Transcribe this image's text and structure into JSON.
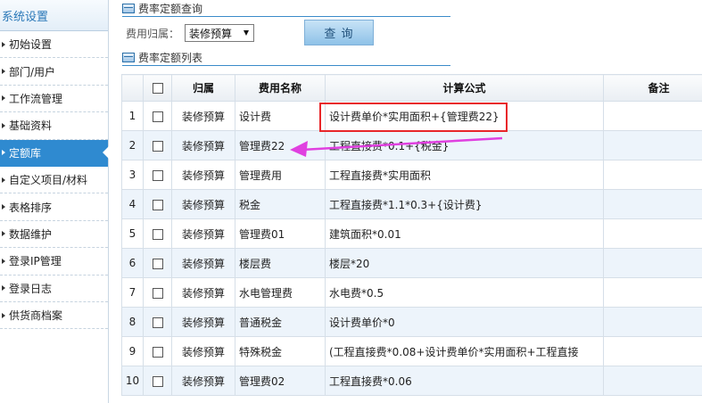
{
  "sidebar": {
    "title": "系统设置",
    "items": [
      {
        "label": "初始设置",
        "active": false
      },
      {
        "label": "部门/用户",
        "active": false
      },
      {
        "label": "工作流管理",
        "active": false
      },
      {
        "label": "基础资料",
        "active": false
      },
      {
        "label": "定额库",
        "active": true
      },
      {
        "label": "自定义项目/材料",
        "active": false
      },
      {
        "label": "表格排序",
        "active": false
      },
      {
        "label": "数据维护",
        "active": false
      },
      {
        "label": "登录IP管理",
        "active": false
      },
      {
        "label": "登录日志",
        "active": false
      },
      {
        "label": "供货商档案",
        "active": false
      }
    ]
  },
  "query": {
    "section_title": "费率定额查询",
    "filter_label": "费用归属：",
    "filter_value": "装修预算",
    "button_label": "查 询"
  },
  "list": {
    "section_title": "费率定额列表",
    "columns": {
      "owner": "归属",
      "name": "费用名称",
      "formula": "计算公式",
      "remark": "备注"
    },
    "rows": [
      {
        "no": "1",
        "owner": "装修预算",
        "name": "设计费",
        "formula": "设计费单价*实用面积+{管理费22}"
      },
      {
        "no": "2",
        "owner": "装修预算",
        "name": "管理费22",
        "formula": "工程直接费*0.1+{税金}"
      },
      {
        "no": "3",
        "owner": "装修预算",
        "name": "管理费用",
        "formula": "工程直接费*实用面积"
      },
      {
        "no": "4",
        "owner": "装修预算",
        "name": "税金",
        "formula": "工程直接费*1.1*0.3+{设计费}"
      },
      {
        "no": "5",
        "owner": "装修预算",
        "name": "管理费01",
        "formula": "建筑面积*0.01"
      },
      {
        "no": "6",
        "owner": "装修预算",
        "name": "楼层费",
        "formula": "楼层*20"
      },
      {
        "no": "7",
        "owner": "装修预算",
        "name": "水电管理费",
        "formula": "水电费*0.5"
      },
      {
        "no": "8",
        "owner": "装修预算",
        "name": "普通税金",
        "formula": "设计费单价*0"
      },
      {
        "no": "9",
        "owner": "装修预算",
        "name": "特殊税金",
        "formula": "(工程直接费*0.08+设计费单价*实用面积+工程直接"
      },
      {
        "no": "10",
        "owner": "装修预算",
        "name": "管理费02",
        "formula": "工程直接费*0.06"
      }
    ]
  },
  "colors": {
    "accent": "#2f8ad0",
    "highlight": "#e8262a",
    "arrow": "#e040e0"
  }
}
